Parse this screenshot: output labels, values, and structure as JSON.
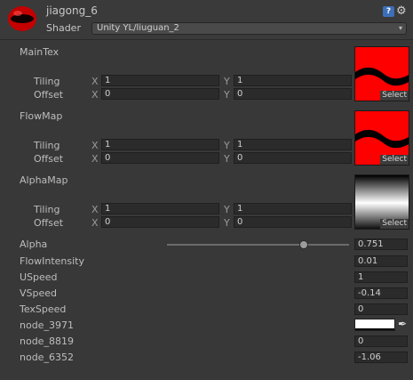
{
  "header": {
    "material_name": "jiagong_6",
    "shader_label": "Shader",
    "shader_value": "Unity YL/liuguan_2"
  },
  "textures": [
    {
      "name": "MainTex",
      "tiling_label": "Tiling",
      "offset_label": "Offset",
      "x_label": "X",
      "y_label": "Y",
      "tiling_x": "1",
      "tiling_y": "1",
      "offset_x": "0",
      "offset_y": "0",
      "select_label": "Select",
      "preview": "red-black-wave"
    },
    {
      "name": "FlowMap",
      "tiling_label": "Tiling",
      "offset_label": "Offset",
      "x_label": "X",
      "y_label": "Y",
      "tiling_x": "1",
      "tiling_y": "1",
      "offset_x": "0",
      "offset_y": "0",
      "select_label": "Select",
      "preview": "red-black-wave"
    },
    {
      "name": "AlphaMap",
      "tiling_label": "Tiling",
      "offset_label": "Offset",
      "x_label": "X",
      "y_label": "Y",
      "tiling_x": "1",
      "tiling_y": "1",
      "offset_x": "0",
      "offset_y": "0",
      "select_label": "Select",
      "preview": "black-white-gradient"
    }
  ],
  "properties": {
    "alpha": {
      "label": "Alpha",
      "value": "0.751",
      "slider_fraction": 0.751
    },
    "flow_intensity": {
      "label": "FlowIntensity",
      "value": "0.01"
    },
    "uspeed": {
      "label": "USpeed",
      "value": "1"
    },
    "vspeed": {
      "label": "VSpeed",
      "value": "-0.14"
    },
    "tex_speed": {
      "label": "TexSpeed",
      "value": "0"
    },
    "node_3971": {
      "label": "node_3971",
      "color": "#ffffff"
    },
    "node_8819": {
      "label": "node_8819",
      "value": "0"
    },
    "node_6352": {
      "label": "node_6352",
      "value": "-1.06"
    }
  },
  "icons": {
    "material": "material-sphere-icon",
    "help": "help-icon",
    "settings": "gear-icon",
    "color_picker": "eyedropper-icon"
  },
  "colors": {
    "accent_red": "#ff0000",
    "background": "#383838"
  }
}
